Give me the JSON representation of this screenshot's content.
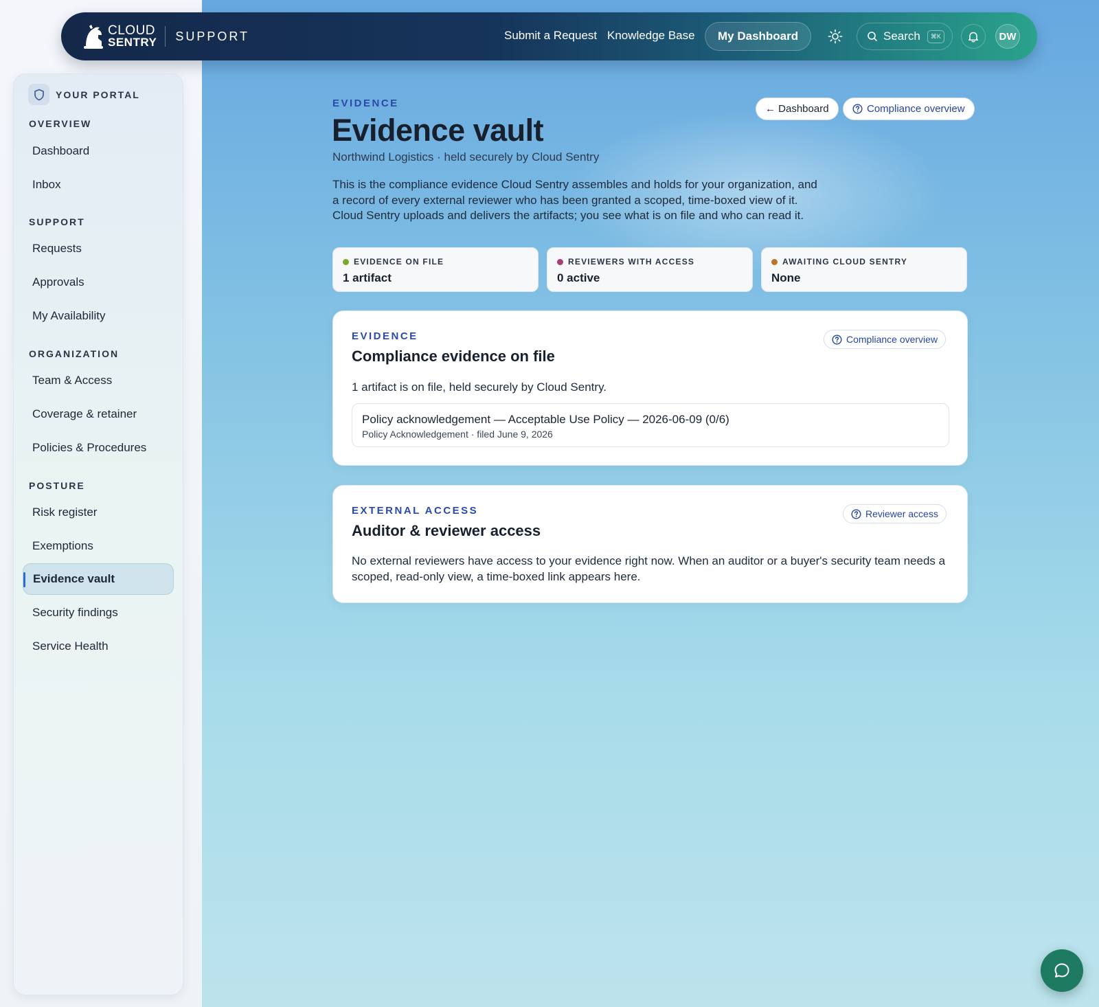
{
  "nav": {
    "brand_line1": "CLOUD",
    "brand_line2": "SENTRY",
    "brand_product": "SUPPORT",
    "links": [
      "Submit a Request",
      "Knowledge Base"
    ],
    "active_link": "My Dashboard",
    "search_label": "Search",
    "search_shortcut": "⌘K",
    "avatar_initials": "DW"
  },
  "sidebar": {
    "portal_label": "YOUR PORTAL",
    "sections": [
      {
        "label": "OVERVIEW",
        "items": [
          "Dashboard",
          "Inbox"
        ]
      },
      {
        "label": "SUPPORT",
        "items": [
          "Requests",
          "Approvals",
          "My Availability"
        ]
      },
      {
        "label": "ORGANIZATION",
        "items": [
          "Team & Access",
          "Coverage & retainer",
          "Policies & Procedures"
        ]
      },
      {
        "label": "POSTURE",
        "items": [
          "Risk register",
          "Exemptions",
          "Evidence vault",
          "Security findings",
          "Service Health"
        ]
      }
    ],
    "active_item": "Evidence vault"
  },
  "header": {
    "eyebrow": "EVIDENCE",
    "title": "Evidence vault",
    "subtitle": "Northwind Logistics · held securely by Cloud Sentry",
    "description": "This is the compliance evidence Cloud Sentry assembles and holds for your organization, and a record of every external reviewer who has been granted a scoped, time-boxed view of it. Cloud Sentry uploads and delivers the artifacts; you see what is on file and who can read it.",
    "back_button": "← Dashboard",
    "overview_button": "Compliance overview"
  },
  "stats": [
    {
      "label": "EVIDENCE ON FILE",
      "value": "1 artifact",
      "color": "#7aa82a"
    },
    {
      "label": "REVIEWERS WITH ACCESS",
      "value": "0 active",
      "color": "#a83e76"
    },
    {
      "label": "AWAITING CLOUD SENTRY",
      "value": "None",
      "color": "#b8742a"
    }
  ],
  "evidence_card": {
    "eyebrow": "EVIDENCE",
    "title": "Compliance evidence on file",
    "help_button": "Compliance overview",
    "summary": "1 artifact is on file, held securely by Cloud Sentry.",
    "artifact": {
      "title": "Policy acknowledgement — Acceptable Use Policy — 2026-06-09 (0/6)",
      "meta": "Policy Acknowledgement · filed June 9, 2026"
    }
  },
  "access_card": {
    "eyebrow": "EXTERNAL ACCESS",
    "title": "Auditor & reviewer access",
    "help_button": "Reviewer access",
    "body": "No external reviewers have access to your evidence right now. When an auditor or a buyer's security team needs a scoped, read-only view, a time-boxed link appears here."
  },
  "colors": {
    "accent": "#2b4aa8",
    "nav_dark": "#14284a",
    "nav_teal": "#2aa38c",
    "chat": "#1f7a62"
  }
}
